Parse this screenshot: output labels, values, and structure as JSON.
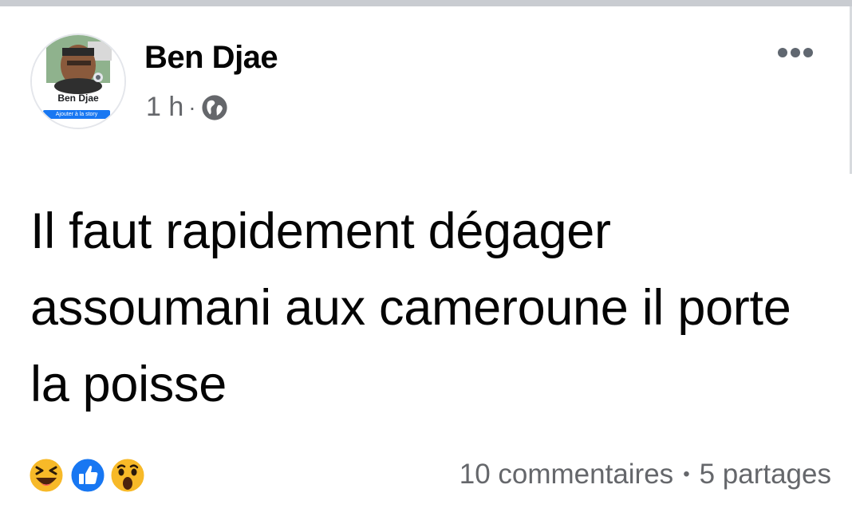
{
  "post": {
    "author": "Ben Djae",
    "time": "1 h",
    "separator": "·",
    "privacy_icon": "globe-icon",
    "text": "Il faut rapidement dégager assoumani aux cameroune il porte la poisse"
  },
  "avatar": {
    "name": "Ben Djae",
    "story_label": "Ajouter à la story"
  },
  "reactions": {
    "icons": [
      "haha-icon",
      "like-icon",
      "wow-icon"
    ]
  },
  "stats": {
    "comments": "10 commentaires",
    "separator": "•",
    "shares": "5 partages"
  },
  "colors": {
    "accent": "#1877f2",
    "secondary_text": "#65676b",
    "reaction_yellow": "#f7b928"
  }
}
